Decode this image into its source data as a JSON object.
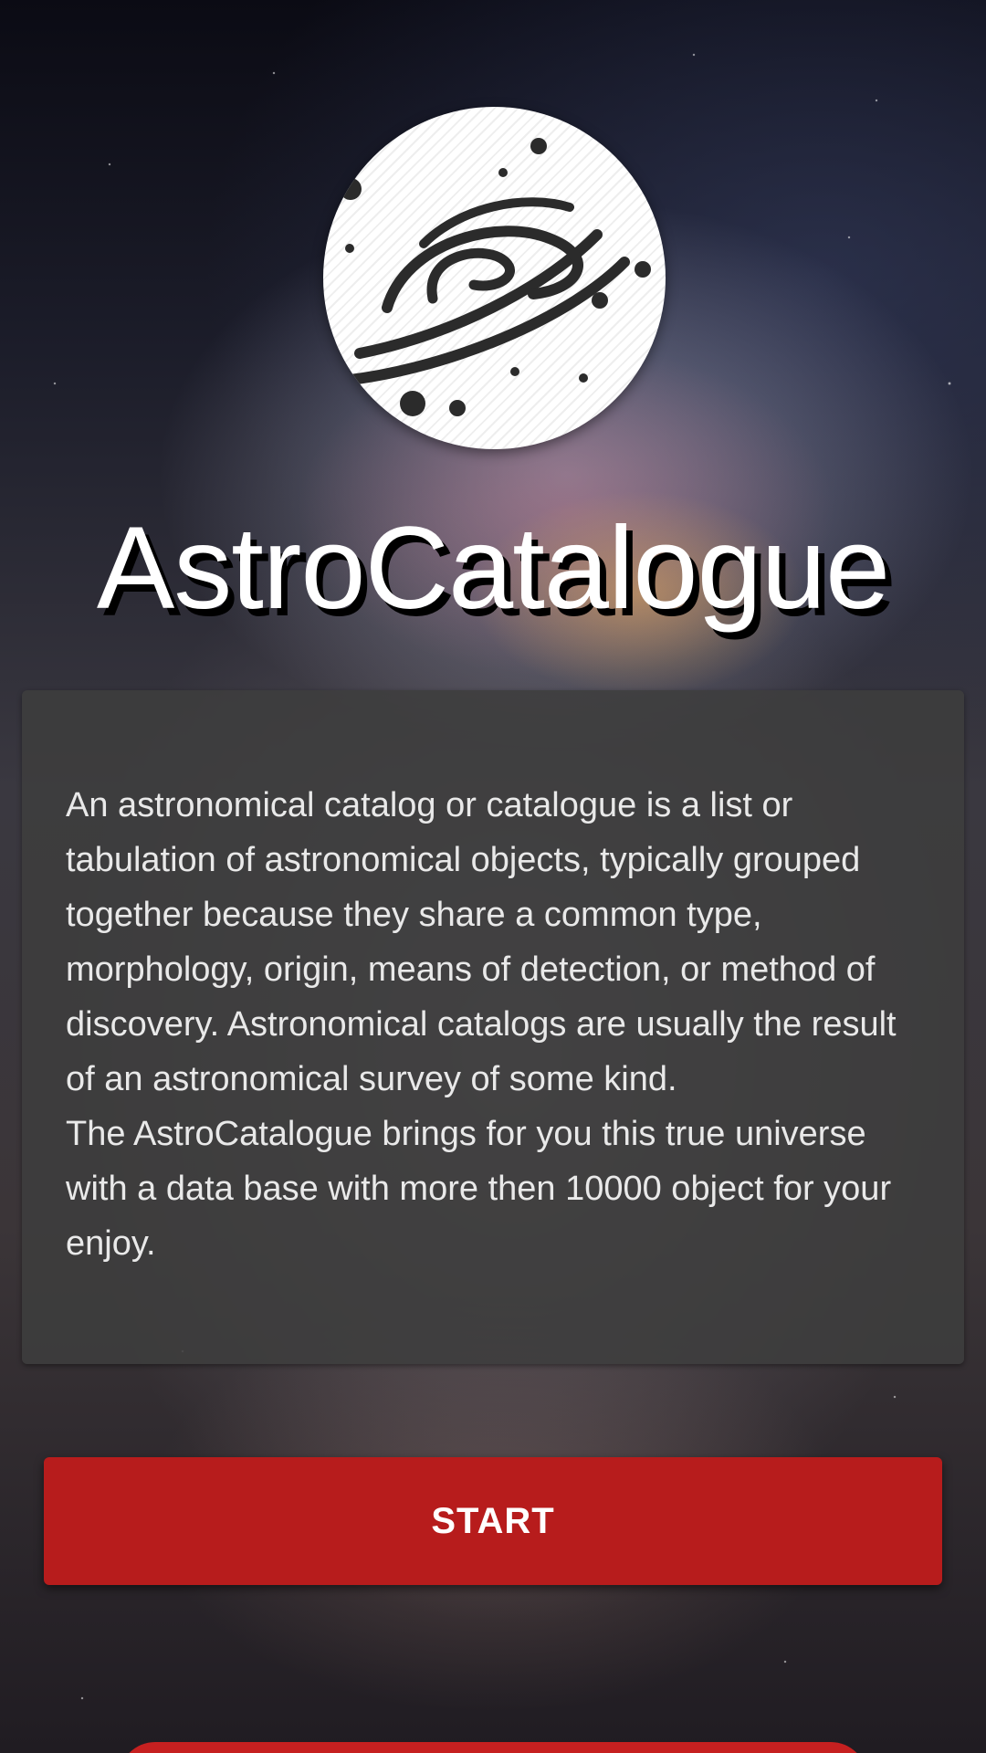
{
  "app": {
    "title": "AstroCatalogue",
    "logo_icon": "galaxy-icon"
  },
  "description": {
    "text": "An astronomical catalog or catalogue is a list or tabulation of astronomical objects, typically grouped together because they share a common type, morphology, origin, means of detection, or method of discovery. Astronomical catalogs are usually the result of an astronomical survey of some kind.\nThe AstroCatalogue brings for you this true universe with a data base with more then 10000 object for your enjoy."
  },
  "actions": {
    "start_label": "START"
  },
  "colors": {
    "accent": "#b71c1c",
    "card": "#3e3e3e",
    "text": "#ffffff"
  }
}
